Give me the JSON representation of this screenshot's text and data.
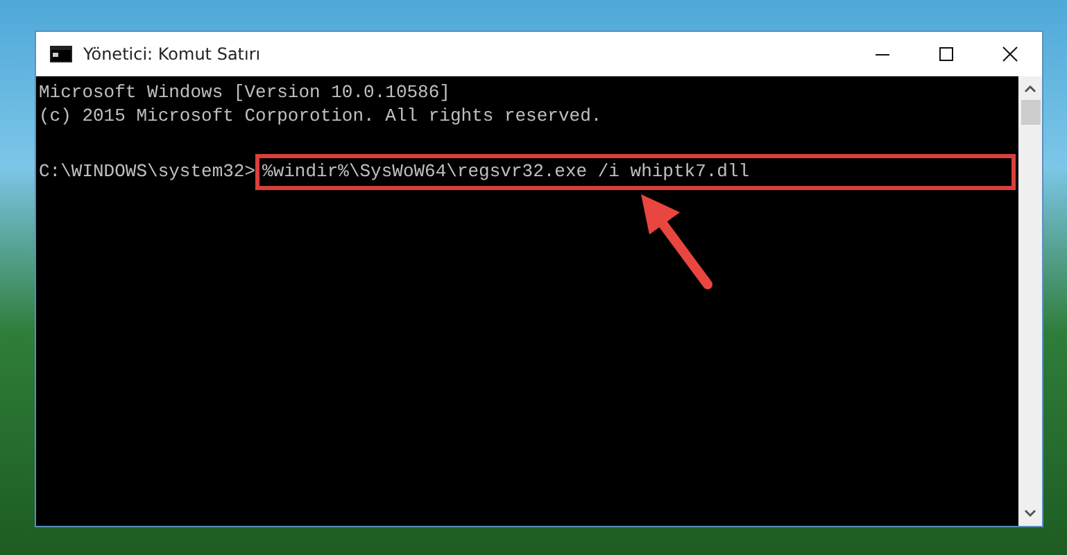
{
  "window": {
    "title": "Yönetici: Komut Satırı"
  },
  "console": {
    "lines": [
      "Microsoft Windows [Version 10.0.10586]",
      "(c) 2015 Microsoft Corporotion. All rights reserved."
    ],
    "prompt": "C:\\WINDOWS\\system32>",
    "command": "%windir%\\SysWoW64\\regsvr32.exe /i whiptk7.dll"
  }
}
